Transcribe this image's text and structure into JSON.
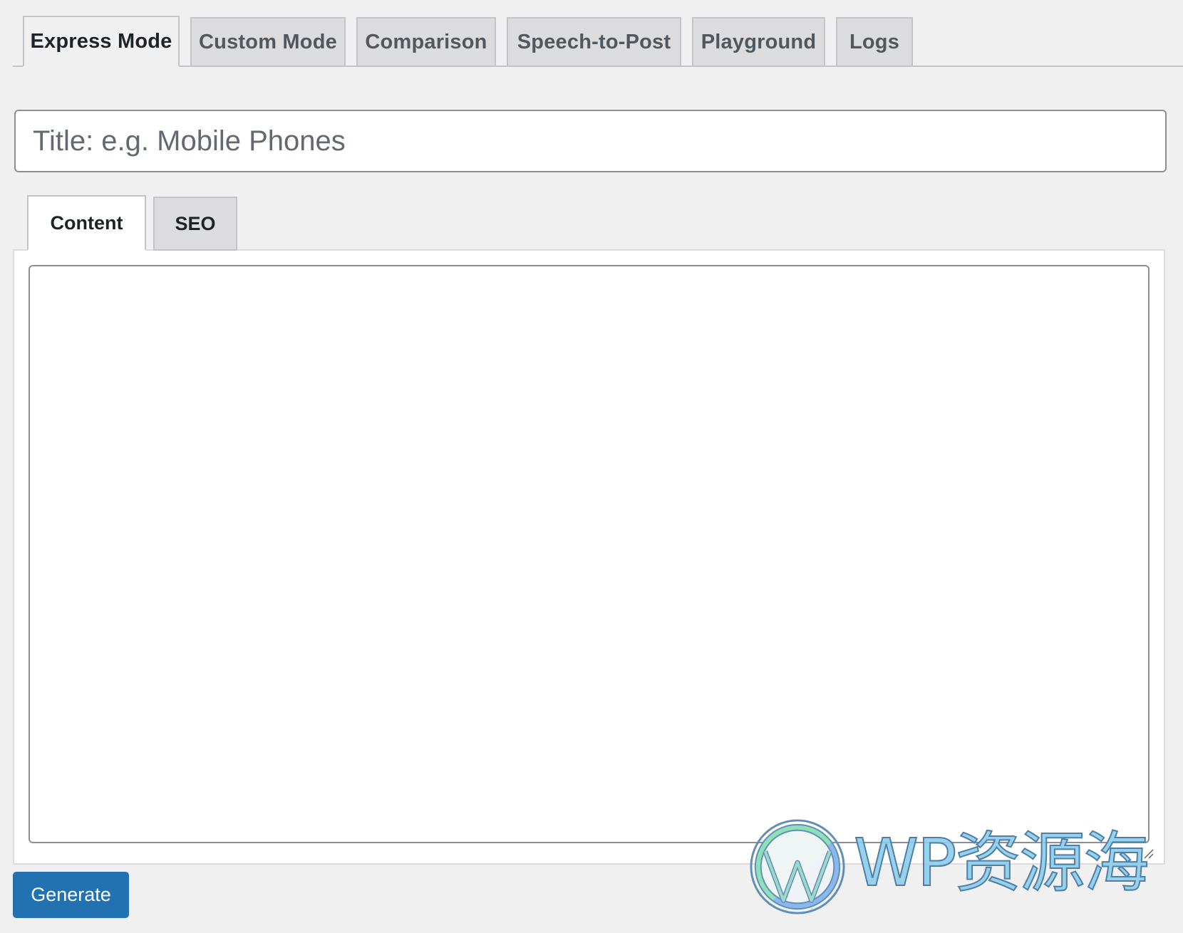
{
  "top_tabs": [
    {
      "label": "Express Mode",
      "active": true
    },
    {
      "label": "Custom Mode",
      "active": false
    },
    {
      "label": "Comparison",
      "active": false
    },
    {
      "label": "Speech-to-Post",
      "active": false
    },
    {
      "label": "Playground",
      "active": false
    },
    {
      "label": "Logs",
      "active": false
    }
  ],
  "title_input": {
    "placeholder": "Title: e.g. Mobile Phones",
    "value": ""
  },
  "inner_tabs": [
    {
      "label": "Content",
      "active": true
    },
    {
      "label": "SEO",
      "active": false
    }
  ],
  "content_textarea": {
    "value": ""
  },
  "generate_button": {
    "label": "Generate"
  },
  "watermark": {
    "text": "WP资源海",
    "icon": "wordpress-logo-icon"
  },
  "colors": {
    "background": "#f0f0f1",
    "tab_inactive_bg": "#dcdcde",
    "border": "#c3c4c7",
    "input_border": "#8c8f94",
    "primary_button": "#2271b1",
    "text": "#1d2327",
    "muted_text": "#50575e",
    "placeholder": "#646970"
  }
}
